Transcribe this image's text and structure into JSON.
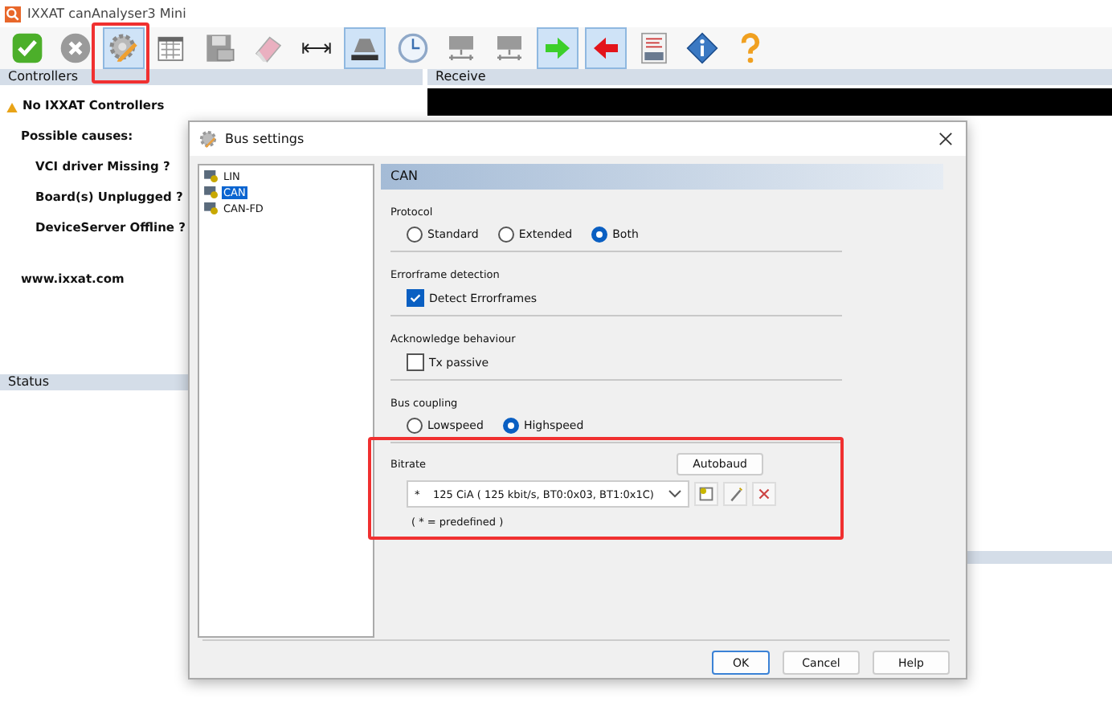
{
  "window": {
    "title": "IXXAT canAnalyser3 Mini"
  },
  "toolbar": [
    {
      "kind": "check",
      "selected": false
    },
    {
      "kind": "cancel",
      "selected": false
    },
    {
      "kind": "settings",
      "selected": true
    },
    {
      "kind": "filter",
      "selected": false
    },
    {
      "kind": "save",
      "selected": false
    },
    {
      "kind": "eraser",
      "selected": false
    },
    {
      "kind": "width",
      "selected": false
    },
    {
      "kind": "display",
      "selected": true
    },
    {
      "kind": "clock",
      "selected": false
    },
    {
      "kind": "network",
      "selected": false
    },
    {
      "kind": "network",
      "selected": false
    },
    {
      "kind": "arrow-right",
      "selected": true
    },
    {
      "kind": "arrow-left",
      "selected": true
    },
    {
      "kind": "log",
      "selected": false
    },
    {
      "kind": "info",
      "selected": false
    },
    {
      "kind": "help",
      "selected": false
    }
  ],
  "controllers": {
    "header": "Controllers",
    "title": "No IXXAT Controllers",
    "subtitle": "Possible causes:",
    "causes": [
      "VCI driver Missing ?",
      "Board(s) Unplugged ?",
      "DeviceServer Offline ?"
    ],
    "link": "www.ixxat.com"
  },
  "status": {
    "header": "Status"
  },
  "receive": {
    "header": "Receive"
  },
  "dialog": {
    "title": "Bus settings",
    "tree": [
      {
        "label": "LIN",
        "selected": false
      },
      {
        "label": "CAN",
        "selected": true
      },
      {
        "label": "CAN-FD",
        "selected": false
      }
    ],
    "section_title": "CAN",
    "protocol": {
      "label": "Protocol",
      "options": [
        {
          "label": "Standard",
          "selected": false
        },
        {
          "label": "Extended",
          "selected": false
        },
        {
          "label": "Both",
          "selected": true
        }
      ]
    },
    "errorframe": {
      "label": "Errorframe detection",
      "option": {
        "label": "Detect Errorframes",
        "checked": true
      }
    },
    "acknowledge": {
      "label": "Acknowledge behaviour",
      "option": {
        "label": "Tx passive",
        "checked": false
      }
    },
    "bus_coupling": {
      "label": "Bus coupling",
      "options": [
        {
          "label": "Lowspeed",
          "selected": false
        },
        {
          "label": "Highspeed",
          "selected": true
        }
      ]
    },
    "bitrate": {
      "label": "Bitrate",
      "autobaud": "Autobaud",
      "value": "*    125 CiA ( 125 kbit/s, BT0:0x03, BT1:0x1C)",
      "note": "( * = predefined )"
    },
    "buttons": [
      "OK",
      "Cancel",
      "Help"
    ]
  }
}
